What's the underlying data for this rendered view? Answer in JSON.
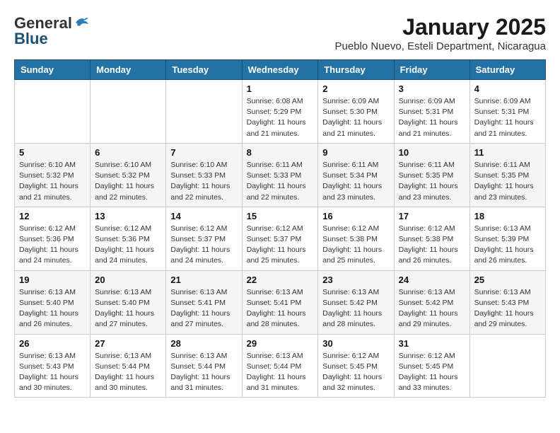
{
  "logo": {
    "general": "General",
    "blue": "Blue"
  },
  "title": {
    "month": "January 2025",
    "location": "Pueblo Nuevo, Esteli Department, Nicaragua"
  },
  "days_of_week": [
    "Sunday",
    "Monday",
    "Tuesday",
    "Wednesday",
    "Thursday",
    "Friday",
    "Saturday"
  ],
  "weeks": [
    [
      {
        "day": "",
        "info": ""
      },
      {
        "day": "",
        "info": ""
      },
      {
        "day": "",
        "info": ""
      },
      {
        "day": "1",
        "info": "Sunrise: 6:08 AM\nSunset: 5:29 PM\nDaylight: 11 hours and 21 minutes."
      },
      {
        "day": "2",
        "info": "Sunrise: 6:09 AM\nSunset: 5:30 PM\nDaylight: 11 hours and 21 minutes."
      },
      {
        "day": "3",
        "info": "Sunrise: 6:09 AM\nSunset: 5:31 PM\nDaylight: 11 hours and 21 minutes."
      },
      {
        "day": "4",
        "info": "Sunrise: 6:09 AM\nSunset: 5:31 PM\nDaylight: 11 hours and 21 minutes."
      }
    ],
    [
      {
        "day": "5",
        "info": "Sunrise: 6:10 AM\nSunset: 5:32 PM\nDaylight: 11 hours and 21 minutes."
      },
      {
        "day": "6",
        "info": "Sunrise: 6:10 AM\nSunset: 5:32 PM\nDaylight: 11 hours and 22 minutes."
      },
      {
        "day": "7",
        "info": "Sunrise: 6:10 AM\nSunset: 5:33 PM\nDaylight: 11 hours and 22 minutes."
      },
      {
        "day": "8",
        "info": "Sunrise: 6:11 AM\nSunset: 5:33 PM\nDaylight: 11 hours and 22 minutes."
      },
      {
        "day": "9",
        "info": "Sunrise: 6:11 AM\nSunset: 5:34 PM\nDaylight: 11 hours and 23 minutes."
      },
      {
        "day": "10",
        "info": "Sunrise: 6:11 AM\nSunset: 5:35 PM\nDaylight: 11 hours and 23 minutes."
      },
      {
        "day": "11",
        "info": "Sunrise: 6:11 AM\nSunset: 5:35 PM\nDaylight: 11 hours and 23 minutes."
      }
    ],
    [
      {
        "day": "12",
        "info": "Sunrise: 6:12 AM\nSunset: 5:36 PM\nDaylight: 11 hours and 24 minutes."
      },
      {
        "day": "13",
        "info": "Sunrise: 6:12 AM\nSunset: 5:36 PM\nDaylight: 11 hours and 24 minutes."
      },
      {
        "day": "14",
        "info": "Sunrise: 6:12 AM\nSunset: 5:37 PM\nDaylight: 11 hours and 24 minutes."
      },
      {
        "day": "15",
        "info": "Sunrise: 6:12 AM\nSunset: 5:37 PM\nDaylight: 11 hours and 25 minutes."
      },
      {
        "day": "16",
        "info": "Sunrise: 6:12 AM\nSunset: 5:38 PM\nDaylight: 11 hours and 25 minutes."
      },
      {
        "day": "17",
        "info": "Sunrise: 6:12 AM\nSunset: 5:38 PM\nDaylight: 11 hours and 26 minutes."
      },
      {
        "day": "18",
        "info": "Sunrise: 6:13 AM\nSunset: 5:39 PM\nDaylight: 11 hours and 26 minutes."
      }
    ],
    [
      {
        "day": "19",
        "info": "Sunrise: 6:13 AM\nSunset: 5:40 PM\nDaylight: 11 hours and 26 minutes."
      },
      {
        "day": "20",
        "info": "Sunrise: 6:13 AM\nSunset: 5:40 PM\nDaylight: 11 hours and 27 minutes."
      },
      {
        "day": "21",
        "info": "Sunrise: 6:13 AM\nSunset: 5:41 PM\nDaylight: 11 hours and 27 minutes."
      },
      {
        "day": "22",
        "info": "Sunrise: 6:13 AM\nSunset: 5:41 PM\nDaylight: 11 hours and 28 minutes."
      },
      {
        "day": "23",
        "info": "Sunrise: 6:13 AM\nSunset: 5:42 PM\nDaylight: 11 hours and 28 minutes."
      },
      {
        "day": "24",
        "info": "Sunrise: 6:13 AM\nSunset: 5:42 PM\nDaylight: 11 hours and 29 minutes."
      },
      {
        "day": "25",
        "info": "Sunrise: 6:13 AM\nSunset: 5:43 PM\nDaylight: 11 hours and 29 minutes."
      }
    ],
    [
      {
        "day": "26",
        "info": "Sunrise: 6:13 AM\nSunset: 5:43 PM\nDaylight: 11 hours and 30 minutes."
      },
      {
        "day": "27",
        "info": "Sunrise: 6:13 AM\nSunset: 5:44 PM\nDaylight: 11 hours and 30 minutes."
      },
      {
        "day": "28",
        "info": "Sunrise: 6:13 AM\nSunset: 5:44 PM\nDaylight: 11 hours and 31 minutes."
      },
      {
        "day": "29",
        "info": "Sunrise: 6:13 AM\nSunset: 5:44 PM\nDaylight: 11 hours and 31 minutes."
      },
      {
        "day": "30",
        "info": "Sunrise: 6:12 AM\nSunset: 5:45 PM\nDaylight: 11 hours and 32 minutes."
      },
      {
        "day": "31",
        "info": "Sunrise: 6:12 AM\nSunset: 5:45 PM\nDaylight: 11 hours and 33 minutes."
      },
      {
        "day": "",
        "info": ""
      }
    ]
  ]
}
